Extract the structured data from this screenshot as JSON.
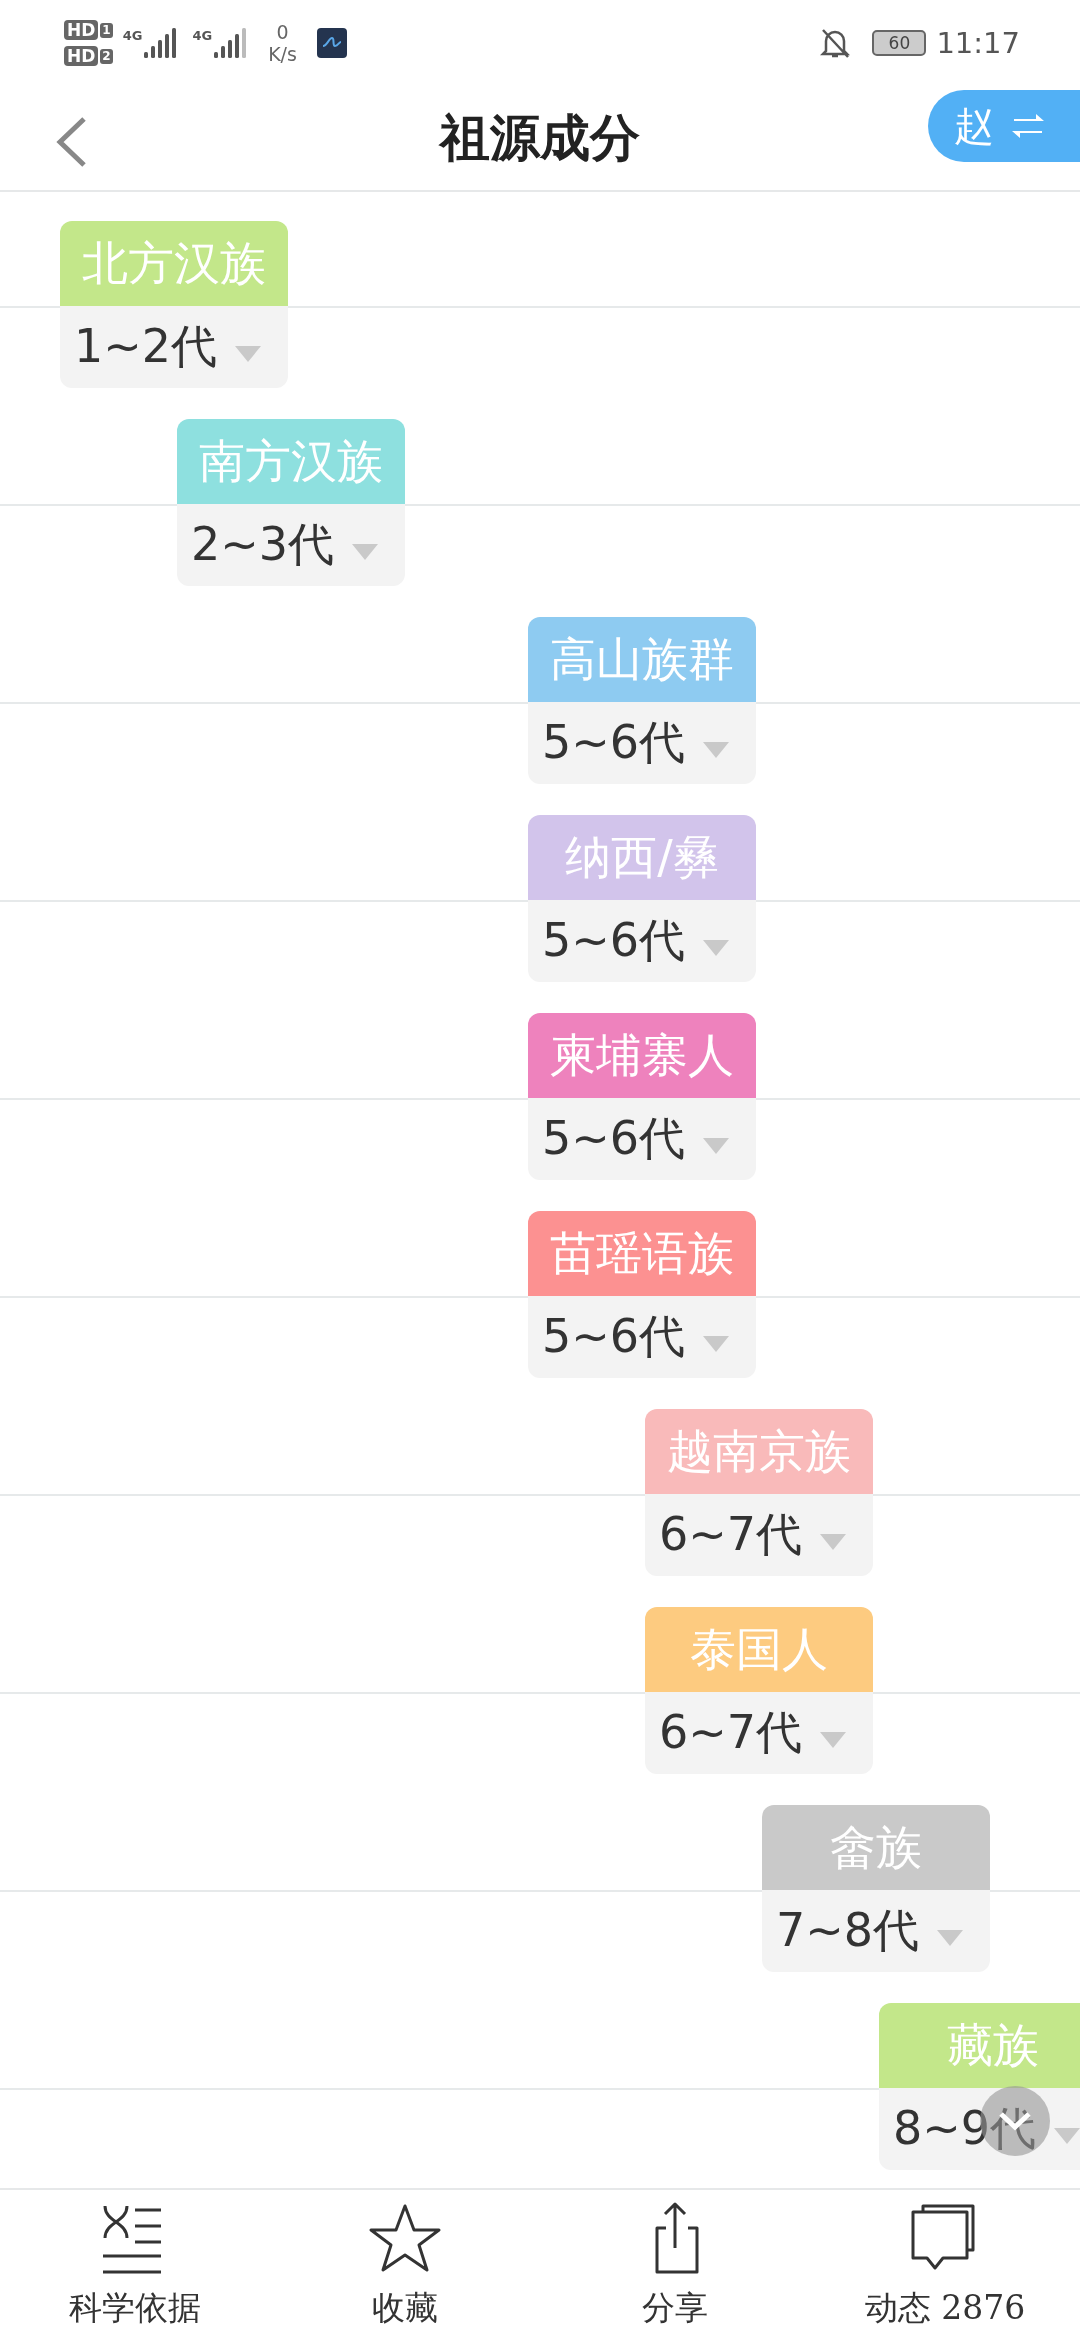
{
  "status_bar": {
    "sims": [
      {
        "badge": "HD",
        "index": "1",
        "network": "4G"
      },
      {
        "badge": "HD",
        "index": "2",
        "network": "4G"
      }
    ],
    "speed_value": "0",
    "speed_unit": "K/s",
    "battery": "60",
    "time": "11:17"
  },
  "header": {
    "title": "祖源成分",
    "switch_label": "赵"
  },
  "components": [
    {
      "name": "北方汉族",
      "generation": "1~2代",
      "color": "#c3e78a"
    },
    {
      "name": "南方汉族",
      "generation": "2~3代",
      "color": "#8ee0df"
    },
    {
      "name": "高山族群",
      "generation": "5~6代",
      "color": "#8ecbf1"
    },
    {
      "name": "纳西/彝",
      "generation": "5~6代",
      "color": "#d2c4eb"
    },
    {
      "name": "柬埔寨人",
      "generation": "5~6代",
      "color": "#ee82bd"
    },
    {
      "name": "苗瑶语族",
      "generation": "5~6代",
      "color": "#fc9191"
    },
    {
      "name": "越南京族",
      "generation": "6~7代",
      "color": "#f9baba"
    },
    {
      "name": "泰国人",
      "generation": "6~7代",
      "color": "#fdcb80"
    },
    {
      "name": "畲族",
      "generation": "7~8代",
      "color": "#c9c9c9"
    },
    {
      "name": "藏族",
      "generation": "8~9代",
      "color": "#c3e78a"
    }
  ],
  "bottom_nav": [
    {
      "kind": "science",
      "label": "科学依据"
    },
    {
      "kind": "star",
      "label": "收藏"
    },
    {
      "kind": "share",
      "label": "分享"
    },
    {
      "kind": "comments",
      "label": "动态 2876"
    }
  ]
}
